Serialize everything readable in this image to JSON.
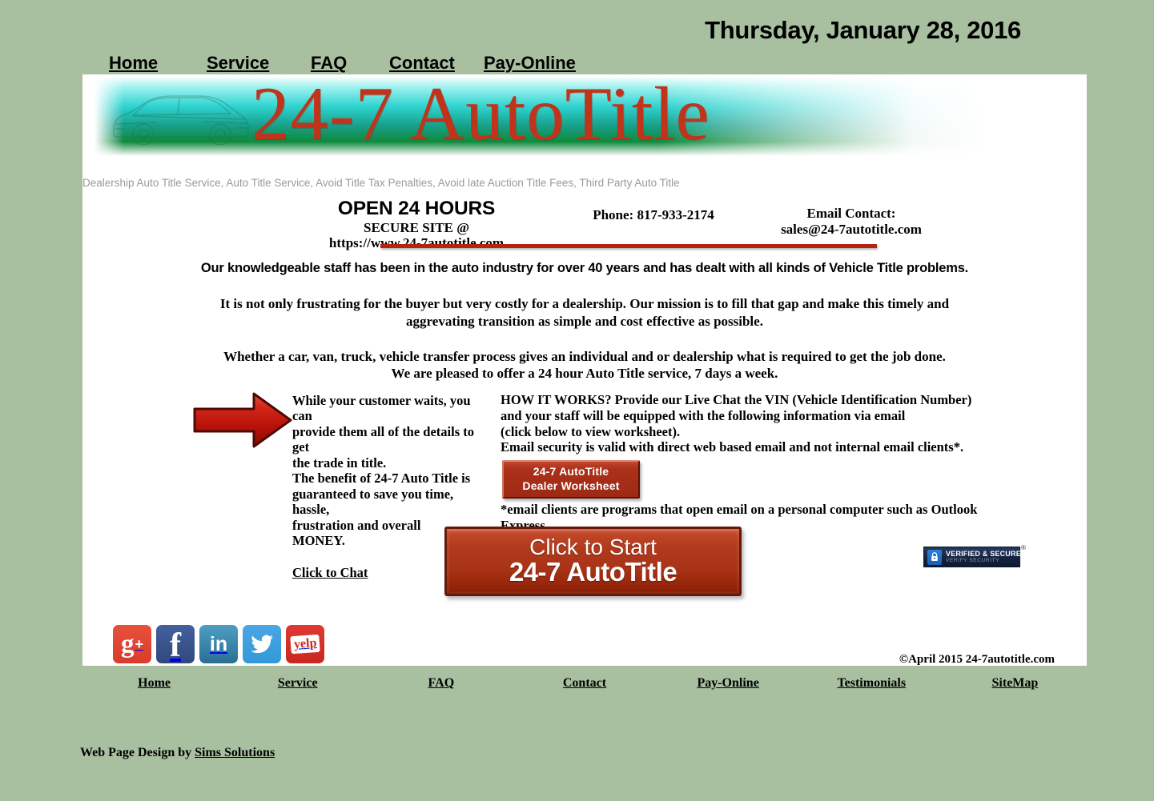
{
  "site": {
    "date": "Thursday, January 28, 2016",
    "logo_text": "24-7 AutoTitle",
    "tagline": "Dealership Auto Title Service, Auto Title Service, Avoid Title Tax Penalties, Avoid late Auction Title Fees, Third Party Auto Title",
    "accent_red": "#b52410",
    "background_green": "#a8c0a0",
    "banner_cyan": "#2fd3d0",
    "banner_green": "#0f8a3c",
    "logo_red": "#c0341c"
  },
  "top_nav": {
    "items": [
      {
        "label": "Home"
      },
      {
        "label": "Service"
      },
      {
        "label": "FAQ"
      },
      {
        "label": "Contact"
      },
      {
        "label": "Pay-Online"
      }
    ]
  },
  "contact": {
    "open_heading": "OPEN 24 HOURS",
    "secure_label": "SECURE SITE @",
    "secure_url": "https://www.24-7autotitle.com",
    "phone": "Phone: 817-933-2174",
    "email_label": "Email Contact:",
    "email": "sales@24-7autotitle.com"
  },
  "intro": {
    "paragraph1": "Our knowledgeable staff has been in the auto industry for over 40 years and has dealt with all kinds of Vehicle Title problems.",
    "paragraph2_line1": "It is not only frustrating for the buyer but very costly for a dealership. Our mission is to fill that gap and make this timely and",
    "paragraph2_line2": "aggrevating transition as simple and cost effective as possible.",
    "paragraph3_line1": "Whether a car, van, truck, vehicle transfer process gives an individual and or dealership what is required to get the job done.",
    "paragraph3_line2": "We are pleased to offer a 24 hour Auto Title service, 7 days a week."
  },
  "left_column": {
    "line1": "While your customer waits, you can",
    "line2": "provide them all of the details to get",
    "line3": "the trade in title.",
    "line4": "The benefit of 24-7 Auto Title is",
    "line5": "guaranteed to save you time, hassle,",
    "line6": "frustration and overall MONEY.",
    "chat_link": "Click to Chat"
  },
  "right_column": {
    "line1": "HOW IT WORKS? Provide our Live Chat the VIN (Vehicle Identification Number)",
    "line2": "and your staff will be equipped with the following information via email",
    "line3": "(click below to view worksheet).",
    "line4": "Email security is valid with direct web based email and not internal email clients*.",
    "worksheet_button_line1": "24-7 AutoTitle",
    "worksheet_button_line2": "Dealer Worksheet",
    "footnote": "*email clients are programs that open email on a personal computer such as Outlook Express."
  },
  "cta": {
    "line1": "Click to Start",
    "line2": "24-7 AutoTitle"
  },
  "badge": {
    "main": "VERIFIED & SECURED",
    "sub": "VERIFY SECURITY",
    "registered": "®"
  },
  "social": {
    "items": [
      {
        "name": "google-plus",
        "glyph": "g",
        "plus": "+"
      },
      {
        "name": "facebook",
        "glyph": "f"
      },
      {
        "name": "linkedin",
        "glyph": "in"
      },
      {
        "name": "twitter",
        "glyph": ""
      },
      {
        "name": "yelp",
        "glyph": "yelp"
      }
    ]
  },
  "copyright": "©April 2015 24-7autotitle.com",
  "footer_nav": {
    "items": [
      {
        "label": "Home"
      },
      {
        "label": "Service"
      },
      {
        "label": "FAQ"
      },
      {
        "label": "Contact"
      },
      {
        "label": "Pay-Online"
      },
      {
        "label": "Testimonials"
      },
      {
        "label": "SiteMap"
      }
    ]
  },
  "credit": {
    "prefix": "Web Page Design by ",
    "link": "Sims Solutions"
  }
}
